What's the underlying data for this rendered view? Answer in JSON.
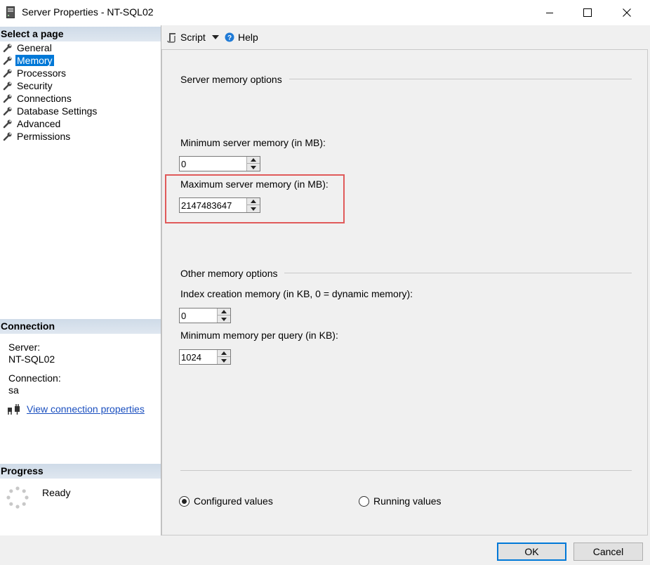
{
  "window": {
    "title": "Server Properties - NT-SQL02",
    "icon": "server-icon",
    "controls": [
      "minimize-icon",
      "maximize-icon",
      "close-icon"
    ]
  },
  "left_panel": {
    "select_page_header": "Select a page",
    "pages": [
      {
        "label": "General",
        "selected": false
      },
      {
        "label": "Memory",
        "selected": true
      },
      {
        "label": "Processors",
        "selected": false
      },
      {
        "label": "Security",
        "selected": false
      },
      {
        "label": "Connections",
        "selected": false
      },
      {
        "label": "Database Settings",
        "selected": false
      },
      {
        "label": "Advanced",
        "selected": false
      },
      {
        "label": "Permissions",
        "selected": false
      }
    ],
    "page_icon": "wrench-icon",
    "connection": {
      "header": "Connection",
      "server_label": "Server:",
      "server_value": "NT-SQL02",
      "connection_label": "Connection:",
      "connection_value": "sa",
      "link_icon": "connection-properties-icon",
      "link_text": "View connection properties"
    },
    "progress": {
      "header": "Progress",
      "icon": "progress-spinner-icon",
      "status": "Ready"
    }
  },
  "toolbar": {
    "script_label": "Script",
    "script_icon": "script-icon",
    "help_label": "Help",
    "help_icon": "help-icon"
  },
  "memory": {
    "server_group_label": "Server memory options",
    "min_label": "Minimum server memory (in MB):",
    "min_value": "0",
    "max_label": "Maximum server memory (in MB):",
    "max_value": "2147483647",
    "highlight_color": "#e05a5a",
    "other_group_label": "Other memory options",
    "index_label": "Index creation memory (in KB, 0 = dynamic memory):",
    "index_value": "0",
    "query_label": "Minimum memory per query (in KB):",
    "query_value": "1024"
  },
  "view_mode": {
    "configured_label": "Configured values",
    "running_label": "Running values",
    "selected": "configured"
  },
  "buttons": {
    "ok_label": "OK",
    "cancel_label": "Cancel",
    "accent": "#0078d7"
  }
}
